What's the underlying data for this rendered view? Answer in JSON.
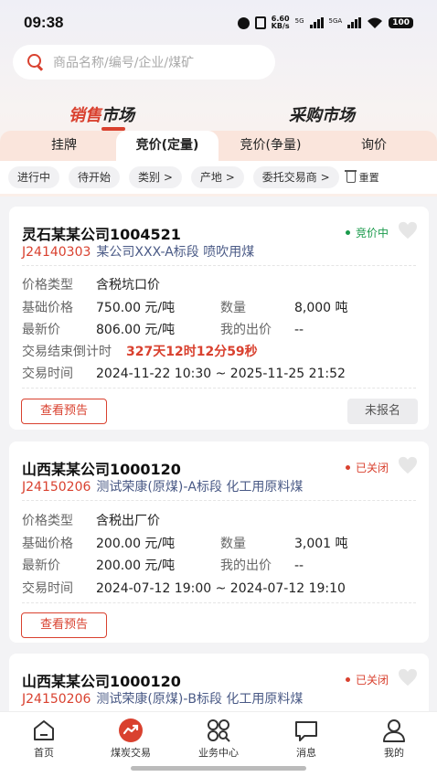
{
  "status_bar": {
    "time": "09:38",
    "speed_top": "6.60",
    "speed_bottom": "KB/s",
    "sig1": "5G",
    "sig2": "5GA",
    "battery": "100"
  },
  "search": {
    "placeholder": "商品名称/编号/企业/煤矿"
  },
  "market_tabs": {
    "sales_prefix": "销",
    "sales_accent": "售",
    "sales_suffix": "市场",
    "purchase": "采购市场"
  },
  "sub_tabs": [
    {
      "label": "挂牌"
    },
    {
      "label": "竞价(定量)"
    },
    {
      "label": "竞价(争量)"
    },
    {
      "label": "询价"
    }
  ],
  "filters": {
    "chips": [
      "进行中",
      "待开始",
      "类别 >",
      "产地 >",
      "委托交易商 >"
    ],
    "reset": "重置"
  },
  "cards": [
    {
      "title": "灵石某某公司1004521",
      "code": "J24140303",
      "desc": "某公司XXX-A标段 喷吹用煤",
      "status": "竞价中",
      "price_type_label": "价格类型",
      "price_type": "含税坑口价",
      "base_price_label": "基础价格",
      "base_price": "750.00 元/吨",
      "qty_label": "数量",
      "qty": "8,000 吨",
      "latest_label": "最新价",
      "latest": "806.00 元/吨",
      "my_bid_label": "我的出价",
      "my_bid": "--",
      "countdown_label": "交易结束倒计时",
      "countdown": "327天12时12分59秒",
      "time_label": "交易时间",
      "time": "2024-11-22 10:30 ~ 2025-11-25 21:52",
      "preview_btn": "查看预告",
      "reg_btn": "未报名"
    },
    {
      "title": "山西某某公司1000120",
      "code": "J24150206",
      "desc": "测试荣康(原煤)-A标段 化工用原料煤",
      "status": "已关闭",
      "price_type_label": "价格类型",
      "price_type": "含税出厂价",
      "base_price_label": "基础价格",
      "base_price": "200.00 元/吨",
      "qty_label": "数量",
      "qty": "3,001 吨",
      "latest_label": "最新价",
      "latest": "200.00 元/吨",
      "my_bid_label": "我的出价",
      "my_bid": "--",
      "time_label": "交易时间",
      "time": "2024-07-12 19:00 ~ 2024-07-12 19:10",
      "preview_btn": "查看预告"
    },
    {
      "title": "山西某某公司1000120",
      "code": "J24150206",
      "desc": "测试荣康(原煤)-B标段 化工用原料煤",
      "status": "已关闭"
    }
  ],
  "bottom_nav": [
    {
      "label": "首页",
      "icon": "home-icon"
    },
    {
      "label": "煤炭交易",
      "icon": "trade-icon"
    },
    {
      "label": "业务中心",
      "icon": "grid-icon"
    },
    {
      "label": "消息",
      "icon": "message-icon"
    },
    {
      "label": "我的",
      "icon": "profile-icon"
    }
  ],
  "colors": {
    "accent": "#d9412f",
    "green": "#1a9a4b",
    "link": "#4a5a86"
  }
}
